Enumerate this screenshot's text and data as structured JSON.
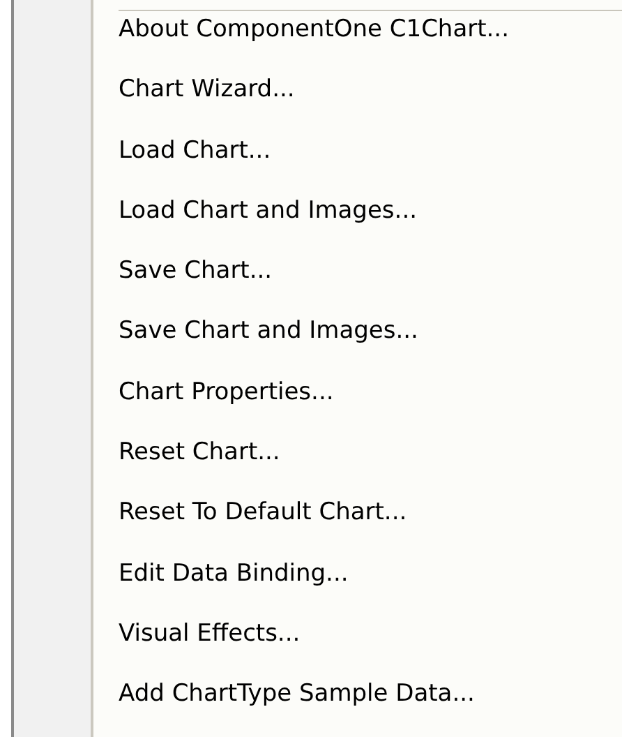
{
  "menu": {
    "items": [
      {
        "label": "About ComponentOne C1Chart..."
      },
      {
        "label": "Chart Wizard..."
      },
      {
        "label": "Load Chart..."
      },
      {
        "label": "Load Chart and Images..."
      },
      {
        "label": "Save Chart..."
      },
      {
        "label": "Save Chart and Images..."
      },
      {
        "label": "Chart Properties..."
      },
      {
        "label": "Reset Chart..."
      },
      {
        "label": "Reset To Default Chart..."
      },
      {
        "label": "Edit Data Binding..."
      },
      {
        "label": "Visual Effects..."
      },
      {
        "label": "Add ChartType Sample Data..."
      }
    ]
  }
}
